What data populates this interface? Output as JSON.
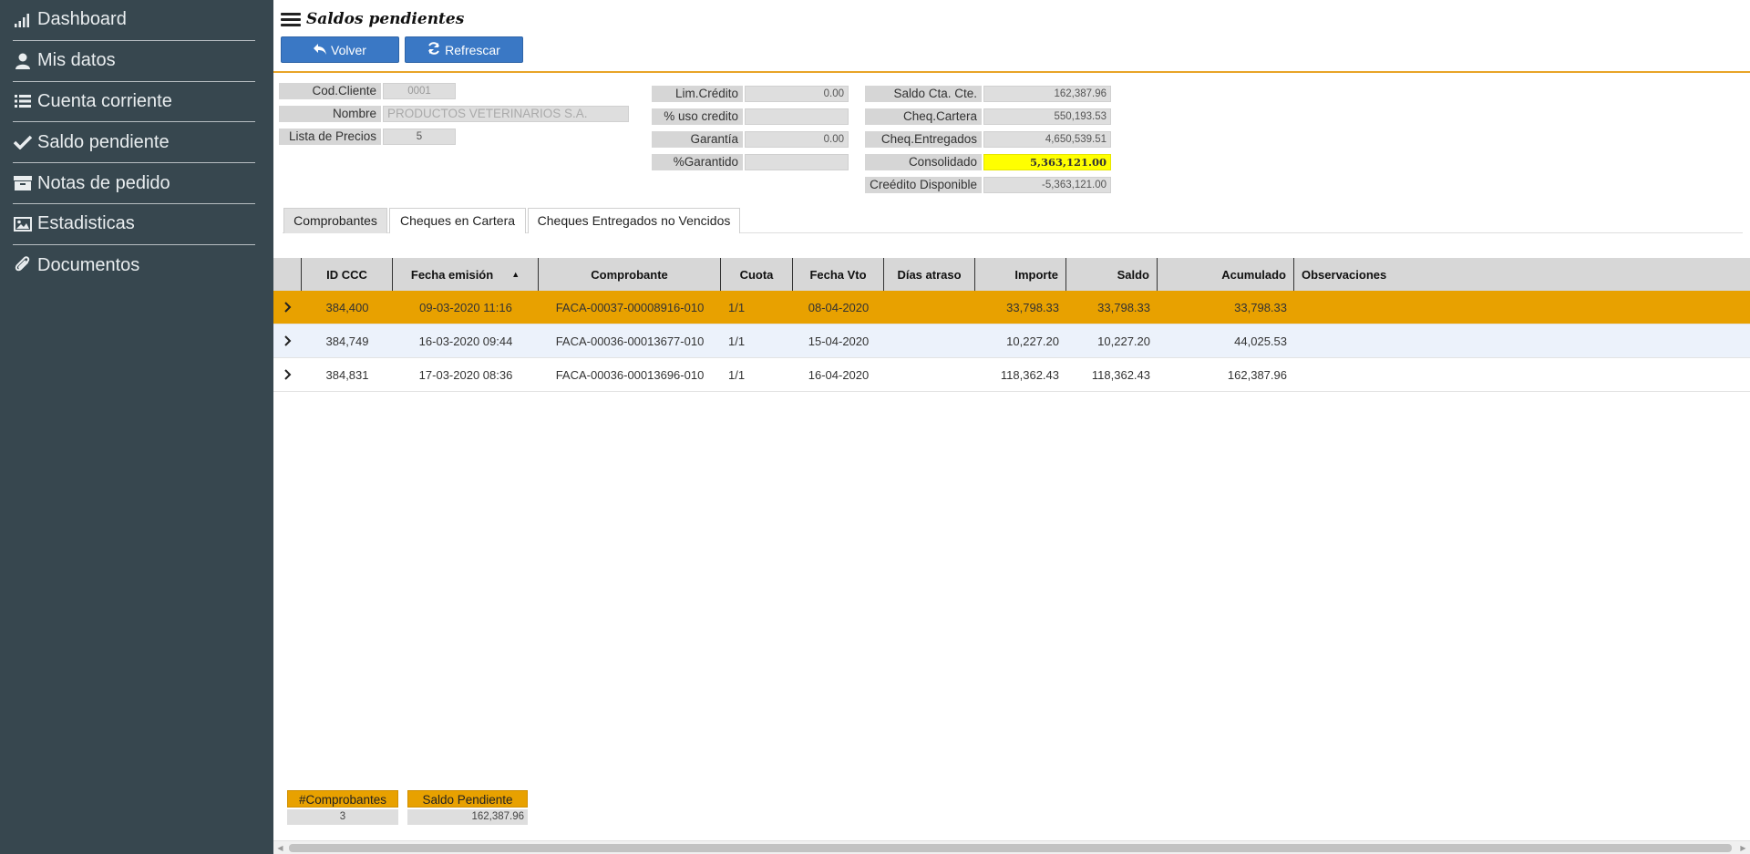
{
  "sidebar": {
    "items": [
      {
        "label": "Dashboard",
        "icon": "signal-bars-icon"
      },
      {
        "label": "Mis datos",
        "icon": "user-icon"
      },
      {
        "label": "Cuenta corriente",
        "icon": "list-icon"
      },
      {
        "label": "Saldo pendiente",
        "icon": "check-icon"
      },
      {
        "label": "Notas de pedido",
        "icon": "archive-icon"
      },
      {
        "label": "Estadisticas",
        "icon": "image-icon"
      },
      {
        "label": "Documentos",
        "icon": "paperclip-icon"
      }
    ]
  },
  "header": {
    "title": "Saldos pendientes",
    "back_label": "Volver",
    "refresh_label": "Refrescar"
  },
  "client": {
    "cod_label": "Cod.Cliente",
    "cod_value": "0001",
    "nombre_label": "Nombre",
    "nombre_value": "PRODUCTOS VETERINARIOS S.A.",
    "lista_label": "Lista de Precios",
    "lista_value": "5"
  },
  "credit": {
    "lim_label": "Lim.Crédito",
    "lim_value": "0.00",
    "uso_label": "% uso credito",
    "uso_value": "",
    "garantia_label": "Garantía",
    "garantia_value": "0.00",
    "pgarantido_label": "%Garantido",
    "pgarantido_value": ""
  },
  "balances": {
    "saldo_label": "Saldo Cta. Cte.",
    "saldo_value": "162,387.96",
    "cartera_label": "Cheq.Cartera",
    "cartera_value": "550,193.53",
    "entregados_label": "Cheq.Entregados",
    "entregados_value": "4,650,539.51",
    "consolidado_label": "Consolidado",
    "consolidado_value": "5,363,121.00",
    "disponible_label": "Creédito Disponible",
    "disponible_value": "-5,363,121.00"
  },
  "tabs": [
    "Comprobantes",
    "Cheques en Cartera",
    "Cheques Entregados no Vencidos"
  ],
  "table": {
    "columns": [
      "ID CCC",
      "Fecha emisión",
      "Comprobante",
      "Cuota",
      "Fecha Vto",
      "Días atraso",
      "Importe",
      "Saldo",
      "Acumulado",
      "Observaciones"
    ],
    "rows": [
      {
        "id": "384,400",
        "fecha": "09-03-2020 11:16",
        "comprobante": "FACA-00037-00008916-010",
        "cuota": "1/1",
        "vto": "08-04-2020",
        "atraso": "",
        "importe": "33,798.33",
        "saldo": "33,798.33",
        "acumulado": "33,798.33",
        "obs": ""
      },
      {
        "id": "384,749",
        "fecha": "16-03-2020 09:44",
        "comprobante": "FACA-00036-00013677-010",
        "cuota": "1/1",
        "vto": "15-04-2020",
        "atraso": "",
        "importe": "10,227.20",
        "saldo": "10,227.20",
        "acumulado": "44,025.53",
        "obs": ""
      },
      {
        "id": "384,831",
        "fecha": "17-03-2020 08:36",
        "comprobante": "FACA-00036-00013696-010",
        "cuota": "1/1",
        "vto": "16-04-2020",
        "atraso": "",
        "importe": "118,362.43",
        "saldo": "118,362.43",
        "acumulado": "162,387.96",
        "obs": ""
      }
    ]
  },
  "summary": {
    "count_label": "#Comprobantes",
    "count_value": "3",
    "saldo_label": "Saldo Pendiente",
    "saldo_value": "162,387.96"
  },
  "colors": {
    "sidebar": "#37474f",
    "accent": "#e8a100",
    "button": "#3a78c5",
    "highlight": "#ffff00"
  }
}
